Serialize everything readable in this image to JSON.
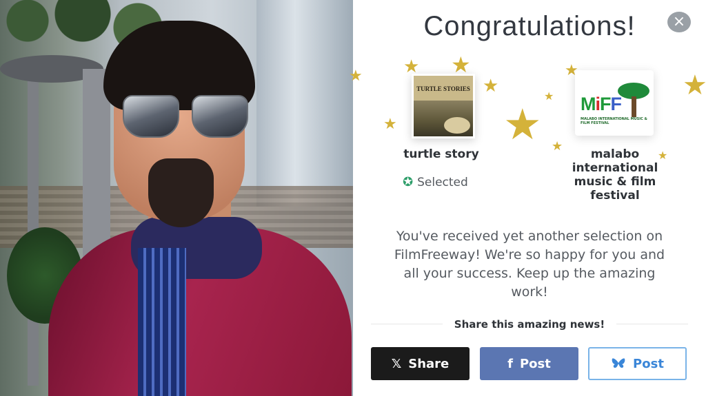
{
  "modal": {
    "title": "Congratulations!",
    "close_label": "×"
  },
  "film": {
    "name": "turtle story",
    "poster_title": "TURTLE STORIES",
    "status": "Selected"
  },
  "festival": {
    "name": "malabo international music & film festival",
    "logo_text": "MiFF",
    "logo_subtext": "MALABO INTERNATIONAL MUSIC & FILM FESTIVAL"
  },
  "message": "You've received yet another selection on FilmFreeway! We're so happy for you and all your success. Keep up the amazing work!",
  "share": {
    "heading": "Share this amazing news!",
    "x_label": "Share",
    "facebook_label": "Post",
    "bluesky_label": "Post"
  },
  "colors": {
    "star": "#d4b23a",
    "selected_icon": "#2e9e6a",
    "x_button": "#1b1b1b",
    "facebook_button": "#5b76b2",
    "bluesky_text": "#3a86d8"
  },
  "icons": {
    "close": "close-icon",
    "selected": "star-check-icon",
    "x": "x-logo-icon",
    "facebook": "facebook-icon",
    "bluesky": "bluesky-butterfly-icon"
  }
}
